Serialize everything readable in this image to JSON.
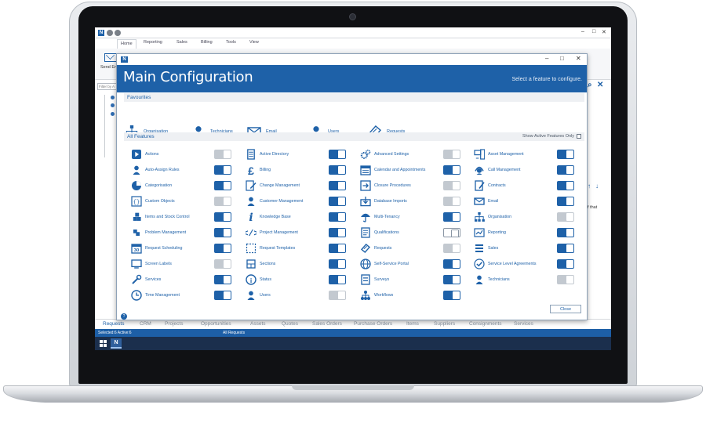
{
  "app": {
    "logo": "N",
    "ribbon_tabs": [
      "Home",
      "Reporting",
      "Sales",
      "Billing",
      "Tools",
      "View"
    ],
    "find_placeholder": "Find Ticket...",
    "go_label": "Go",
    "send_email_label": "Send Ema",
    "filter_placeholder": "Filter by A",
    "right_strip_text": "f that",
    "bottom_tabs": [
      "Requests",
      "CRM",
      "Projects",
      "Opportunities",
      "Assets",
      "Quotes",
      "Sales Orders",
      "Purchase Orders",
      "Items",
      "Suppliers",
      "Consignments",
      "Services"
    ],
    "status_left": "Selected:6  Active:6",
    "status_center": "All Requests"
  },
  "dialog": {
    "logo": "N",
    "title": "Main Configuration",
    "hint": "Select a feature to configure.",
    "favourites_label": "Favourites",
    "favourites": [
      {
        "label": "Organisation",
        "icon": "organisation-icon"
      },
      {
        "label": "Technicians",
        "icon": "technicians-icon"
      },
      {
        "label": "Email",
        "icon": "email-icon"
      },
      {
        "label": "Users",
        "icon": "users-icon"
      },
      {
        "label": "Requests",
        "icon": "requests-icon"
      }
    ],
    "all_features_label": "All Features",
    "show_active_label": "Show Active Features Only",
    "columns": [
      [
        {
          "label": "Actions",
          "icon": "actions-icon",
          "state": "off"
        },
        {
          "label": "Auto-Assign Rules",
          "icon": "auto-assign-icon",
          "state": "on"
        },
        {
          "label": "Categorisation",
          "icon": "categorisation-icon",
          "state": "on"
        },
        {
          "label": "Custom Objects",
          "icon": "custom-objects-icon",
          "state": "off"
        },
        {
          "label": "Items and Stock Control",
          "icon": "items-stock-icon",
          "state": "on"
        },
        {
          "label": "Problem Management",
          "icon": "problem-management-icon",
          "state": "on"
        },
        {
          "label": "Request Scheduling",
          "icon": "calendar-30-icon",
          "state": "on"
        },
        {
          "label": "Screen Labels",
          "icon": "screen-labels-icon",
          "state": "off"
        },
        {
          "label": "Services",
          "icon": "services-icon",
          "state": "on"
        },
        {
          "label": "Time Management",
          "icon": "clock-icon",
          "state": "on"
        }
      ],
      [
        {
          "label": "Active Directory",
          "icon": "active-directory-icon",
          "state": "on"
        },
        {
          "label": "Billing",
          "icon": "pound-icon",
          "state": "on"
        },
        {
          "label": "Change Management",
          "icon": "change-management-icon",
          "state": "on"
        },
        {
          "label": "Customer Management",
          "icon": "customer-icon",
          "state": "on"
        },
        {
          "label": "Knowledge Base",
          "icon": "info-icon",
          "state": "on"
        },
        {
          "label": "Project Management",
          "icon": "code-icon",
          "state": "on"
        },
        {
          "label": "Request Templates",
          "icon": "template-icon",
          "state": "on"
        },
        {
          "label": "Sections",
          "icon": "sections-icon",
          "state": "on"
        },
        {
          "label": "Status",
          "icon": "status-info-icon",
          "state": "on"
        },
        {
          "label": "Users",
          "icon": "users-icon",
          "state": "off"
        }
      ],
      [
        {
          "label": "Advanced Settings",
          "icon": "gears-icon",
          "state": "off"
        },
        {
          "label": "Calendar and Appointments",
          "icon": "calendar-icon",
          "state": "on"
        },
        {
          "label": "Closure Procedures",
          "icon": "closure-icon",
          "state": "off"
        },
        {
          "label": "Database Imports",
          "icon": "database-icon",
          "state": "off"
        },
        {
          "label": "Multi-Tenancy",
          "icon": "umbrella-icon",
          "state": "on"
        },
        {
          "label": "Qualifications",
          "icon": "qualifications-icon",
          "state": "unset"
        },
        {
          "label": "Requests",
          "icon": "requests-icon",
          "state": "off"
        },
        {
          "label": "Self-Service Portal",
          "icon": "globe-icon",
          "state": "on"
        },
        {
          "label": "Surveys",
          "icon": "surveys-icon",
          "state": "on"
        },
        {
          "label": "Workflows",
          "icon": "workflows-icon",
          "state": "on"
        }
      ],
      [
        {
          "label": "Asset Management",
          "icon": "asset-icon",
          "state": "on"
        },
        {
          "label": "Call Management",
          "icon": "headset-icon",
          "state": "on"
        },
        {
          "label": "Contracts",
          "icon": "contracts-icon",
          "state": "on"
        },
        {
          "label": "Email",
          "icon": "email-icon",
          "state": "on"
        },
        {
          "label": "Organisation",
          "icon": "organisation-icon",
          "state": "off"
        },
        {
          "label": "Reporting",
          "icon": "reporting-icon",
          "state": "on"
        },
        {
          "label": "Sales",
          "icon": "sales-icon",
          "state": "on"
        },
        {
          "label": "Service Level Agreements",
          "icon": "sla-icon",
          "state": "on"
        },
        {
          "label": "Technicians",
          "icon": "technicians-icon",
          "state": "off"
        }
      ]
    ],
    "close_label": "Close",
    "help_label": "?"
  },
  "colors": {
    "accent": "#1e61a8",
    "toggle_off": "#c3c9d0",
    "taskbar": "#1b2f4d",
    "section_bg": "#eef0f3"
  }
}
